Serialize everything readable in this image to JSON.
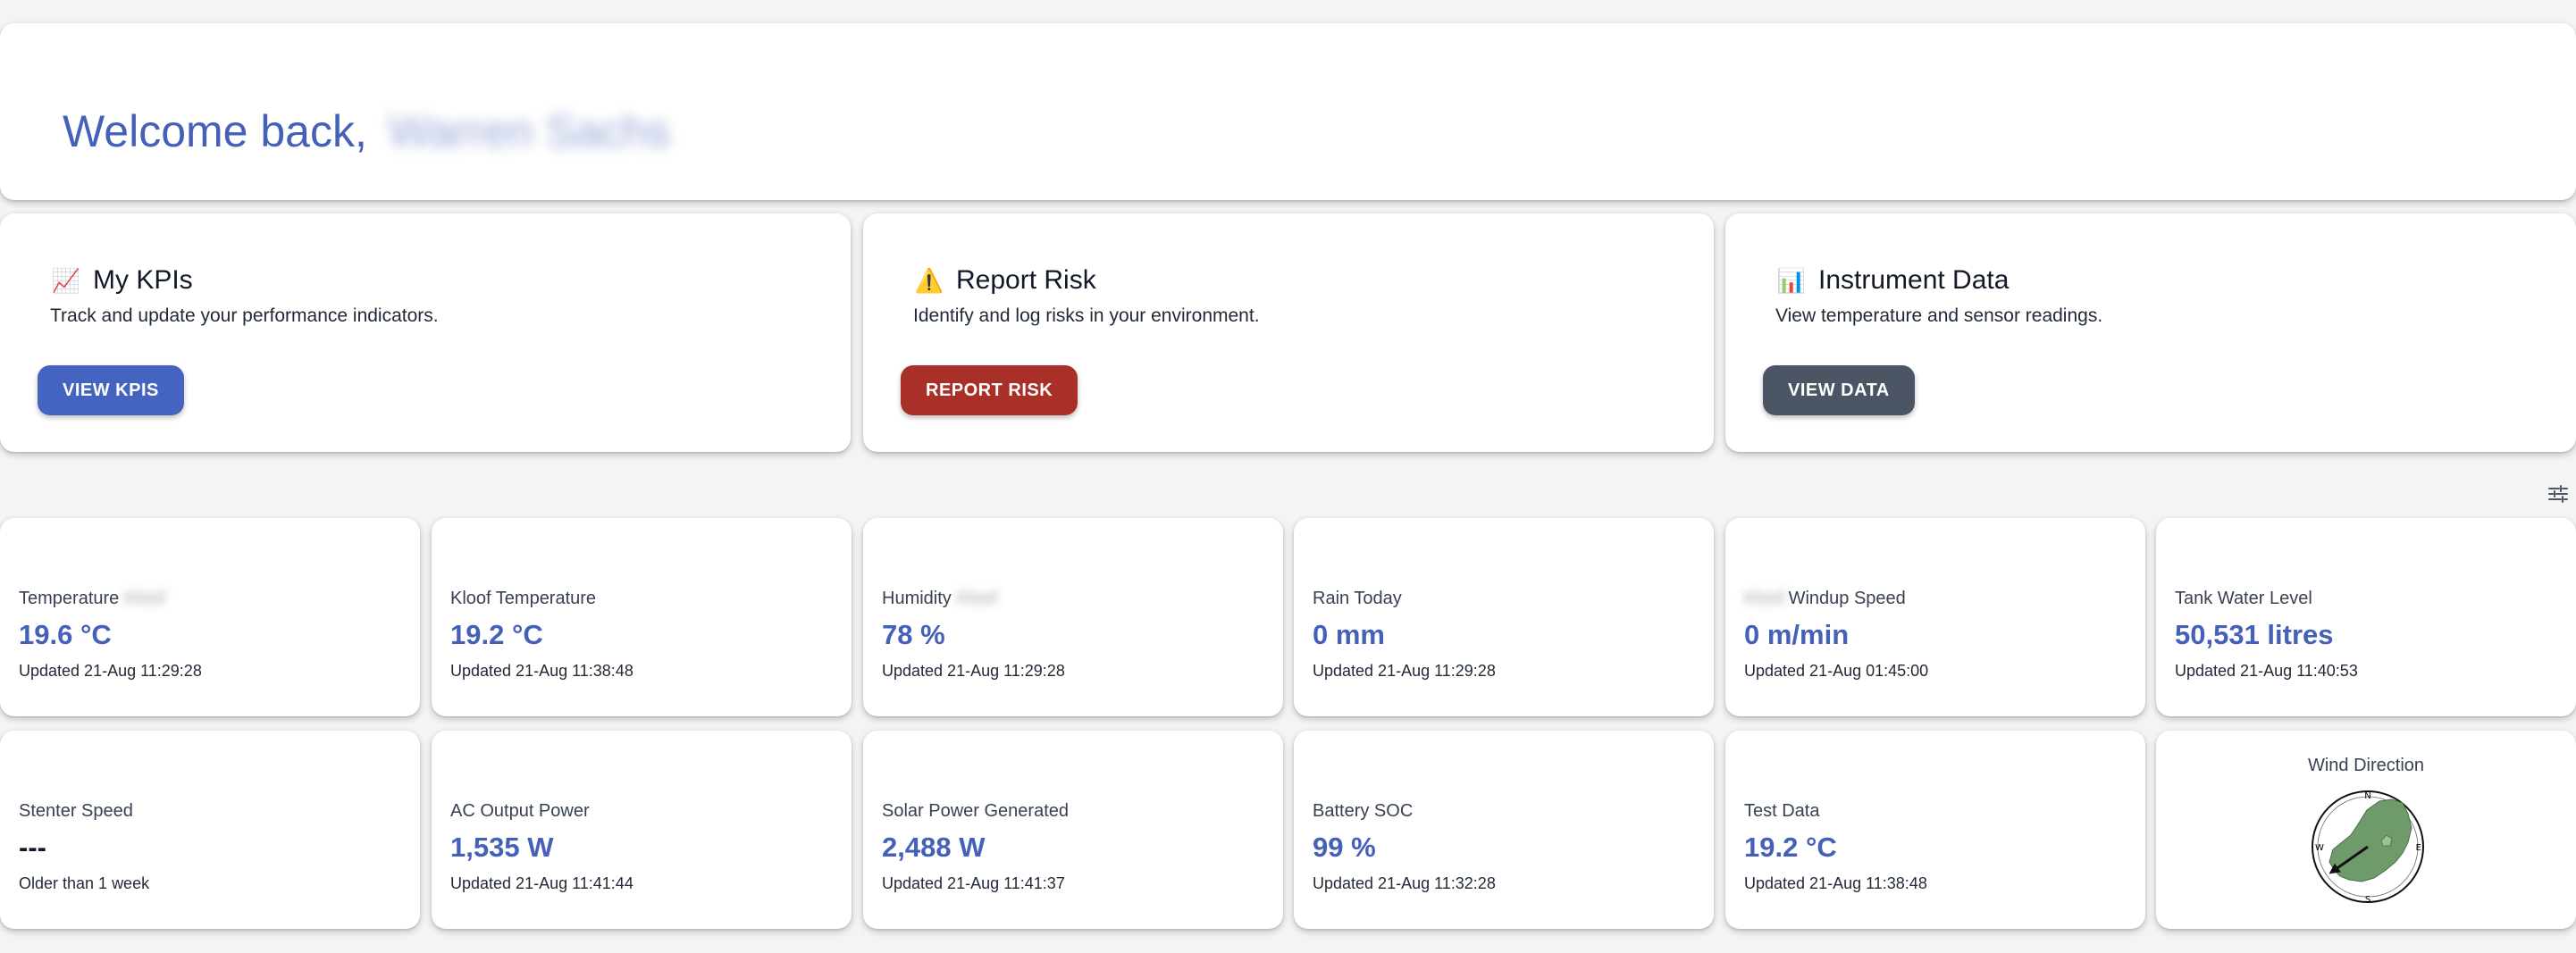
{
  "welcome": {
    "greeting": "Welcome back,",
    "user_name": "Warren Sachs"
  },
  "actions": [
    {
      "emoji": "📈",
      "title": "My KPIs",
      "description": "Track and update your performance indicators.",
      "button": "VIEW KPIS",
      "color": "#4563c0"
    },
    {
      "emoji": "⚠️",
      "title": "Report Risk",
      "description": "Identify and log risks in your environment.",
      "button": "REPORT RISK",
      "color": "#a93029"
    },
    {
      "emoji": "📊",
      "title": "Instrument Data",
      "description": "View temperature and sensor readings.",
      "button": "VIEW DATA",
      "color": "#4b5563"
    }
  ],
  "tiles": [
    {
      "label": "Temperature",
      "blur_suffix": "Kloof",
      "value": "19.6 °C",
      "updated": "Updated 21-Aug 11:29:28"
    },
    {
      "label": "Kloof Temperature",
      "value": "19.2 °C",
      "updated": "Updated 21-Aug 11:38:48"
    },
    {
      "label": "Humidity",
      "blur_suffix": "Kloof",
      "value": "78 %",
      "updated": "Updated 21-Aug 11:29:28"
    },
    {
      "label": "Rain Today",
      "value": "0 mm",
      "updated": "Updated 21-Aug 11:29:28"
    },
    {
      "label": "Windup Speed",
      "blur_prefix": "Kloof",
      "value": "0 m/min",
      "updated": "Updated 21-Aug 01:45:00"
    },
    {
      "label": "Tank Water Level",
      "value": "50,531 litres",
      "updated": "Updated 21-Aug 11:40:53"
    },
    {
      "label": "Stenter Speed",
      "value": "---",
      "updated": "Older than 1 week"
    },
    {
      "label": "AC Output Power",
      "value": "1,535 W",
      "updated": "Updated 21-Aug 11:41:44"
    },
    {
      "label": "Solar Power Generated",
      "value": "2,488 W",
      "updated": "Updated 21-Aug 11:41:37"
    },
    {
      "label": "Battery SOC",
      "value": "99 %",
      "updated": "Updated 21-Aug 11:32:28"
    },
    {
      "label": "Test Data",
      "value": "19.2 °C",
      "updated": "Updated 21-Aug 11:38:48"
    }
  ],
  "wind": {
    "title": "Wind Direction",
    "compass": {
      "n": "N",
      "e": "E",
      "s": "S",
      "w": "W"
    },
    "direction_deg": 235
  },
  "icons": {
    "settings": "sliders-icon"
  },
  "colors": {
    "accent": "#4560b8",
    "background": "#f3f4f6"
  }
}
